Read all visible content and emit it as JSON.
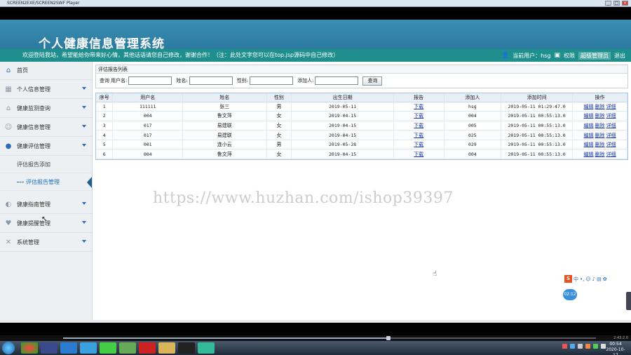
{
  "player": {
    "title": "SCREEN2EXE/SCREEN2SWF Player"
  },
  "header": {
    "title": "个人健康信息管理系统",
    "welcome": "欢迎登陆我站，希望能给你带来好心情，其他话语请您自己修改，谢谢合作！（注：此处文字您可以在top.jsp源码中自己修改）",
    "current_user_label": "当前用户：hsg",
    "permission_label": "权限",
    "admin_label": "超级管理员",
    "logout_label": "退出"
  },
  "sidebar": {
    "home": "首页",
    "items": [
      {
        "label": "个人信息管理",
        "icon": "grid-icon"
      },
      {
        "label": "健康监测查询",
        "icon": "house-icon"
      },
      {
        "label": "健康信息管理",
        "icon": "users-icon"
      },
      {
        "label": "健康评估管理",
        "icon": "user-icon"
      }
    ],
    "sub_items": [
      {
        "label": "评估报告添加"
      },
      {
        "label": "评估报告管理"
      }
    ],
    "items_after": [
      {
        "label": "健康指南管理",
        "icon": "chat-icon"
      },
      {
        "label": "健康提醒管理",
        "icon": "heart-icon"
      },
      {
        "label": "系统管理",
        "icon": "tools-icon"
      }
    ]
  },
  "panel": {
    "title": "评估报告列表",
    "search": {
      "prefix": "查询",
      "username_label": "用户名:",
      "name_label": "姓名:",
      "gender_label": "性别:",
      "adder_label": "添加人:",
      "button": "查询",
      "username_value": "",
      "name_value": "",
      "gender_value": "",
      "adder_value": ""
    },
    "columns": [
      "序号",
      "用户名",
      "姓名",
      "性别",
      "出生日期",
      "报告",
      "添加人",
      "添加时间",
      "操作"
    ],
    "download_label": "下载",
    "actions": [
      "编辑",
      "删除",
      "详细"
    ],
    "rows": [
      {
        "no": "1",
        "username": "111111",
        "name": "张三",
        "gender": "男",
        "birth": "2019-05-11",
        "adder": "hsg",
        "time": "2019-05-11 01:29:47.0"
      },
      {
        "no": "2",
        "username": "004",
        "name": "鲁文萍",
        "gender": "女",
        "birth": "2019-04-15",
        "adder": "004",
        "time": "2019-05-11 00:55:13.0"
      },
      {
        "no": "3",
        "username": "017",
        "name": "易建联",
        "gender": "女",
        "birth": "2019-04-15",
        "adder": "005",
        "time": "2019-05-11 00:55:13.0"
      },
      {
        "no": "4",
        "username": "017",
        "name": "易建联",
        "gender": "女",
        "birth": "2019-04-15",
        "adder": "025",
        "time": "2019-05-11 00:55:13.0"
      },
      {
        "no": "5",
        "username": "001",
        "name": "连小云",
        "gender": "男",
        "birth": "2019-05-28",
        "adder": "029",
        "time": "2019-05-11 00:55:13.0"
      },
      {
        "no": "6",
        "username": "004",
        "name": "鲁文萍",
        "gender": "女",
        "birth": "2019-04-15",
        "adder": "004",
        "time": "2019-05-11 00:55:13.0"
      }
    ]
  },
  "watermark": "https://www.huzhan.com/ishop39397",
  "ime": {
    "logo": "S",
    "lang": "中",
    "bubble": "02:12"
  },
  "seek": {
    "time": "2:43:2.0",
    "progress": 0.61
  },
  "taskbar": {
    "time": "00:54",
    "date": "2020-10-17"
  }
}
